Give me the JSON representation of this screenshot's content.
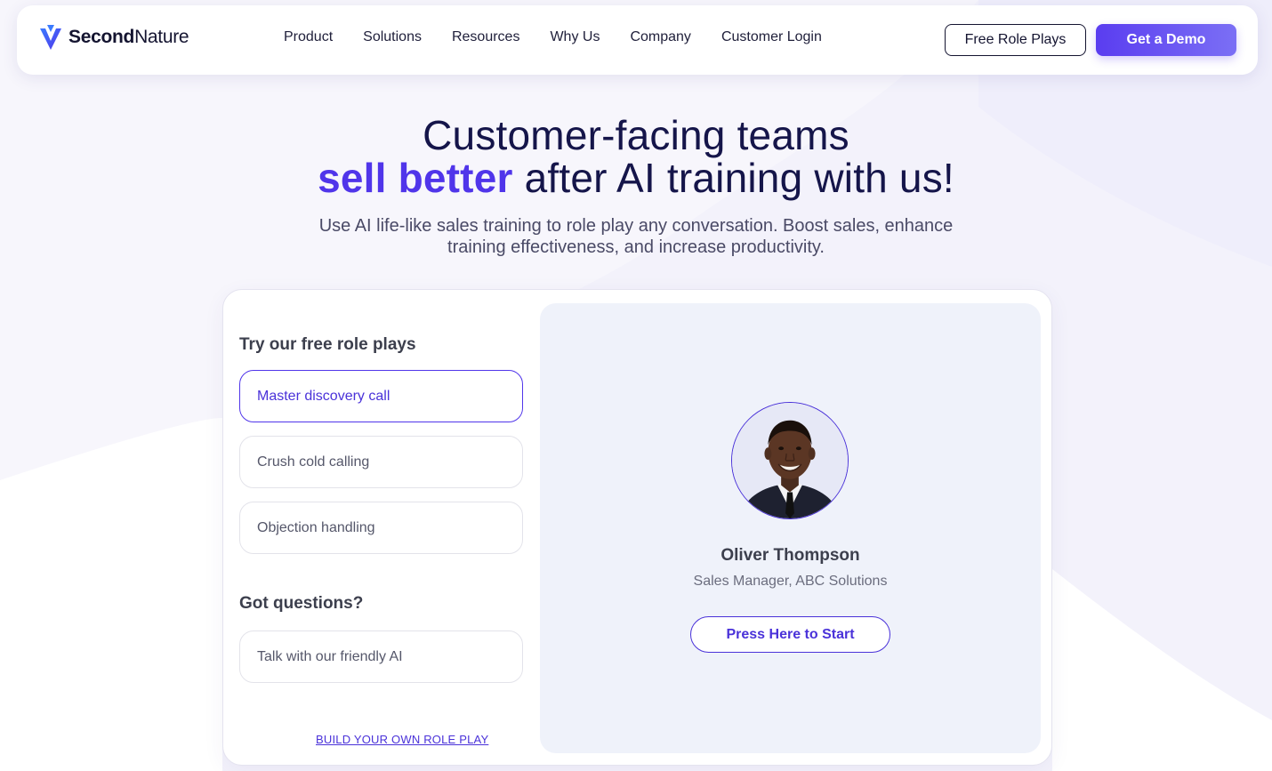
{
  "brand": {
    "name_bold": "Second",
    "name_light": "Nature",
    "logo_icon": "secondnature-logo-icon",
    "accent_color": "#5035ea",
    "primary_gradient": [
      "#5a3df0",
      "#7b6ff5"
    ]
  },
  "nav": {
    "links": [
      "Product",
      "Solutions",
      "Resources",
      "Why Us",
      "Company",
      "Customer Login"
    ],
    "free_role_plays_label": "Free Role Plays",
    "get_demo_label": "Get a Demo"
  },
  "hero": {
    "title_line1": "Customer-facing teams",
    "title_accent": "sell better",
    "title_rest": " after AI training with us!",
    "subtitle": "Use AI life-like sales training to role play any conversation. Boost sales, enhance training effectiveness, and increase productivity."
  },
  "role_plays": {
    "title": "Try our free role plays",
    "options": [
      {
        "label": "Master discovery call",
        "active": true
      },
      {
        "label": "Crush cold calling",
        "active": false
      },
      {
        "label": "Objection handling",
        "active": false
      }
    ],
    "questions_title": "Got questions?",
    "ai_chat_label": "Talk with our friendly AI",
    "build_link": "BUILD YOUR OWN ROLE PLAY"
  },
  "persona": {
    "name": "Oliver Thompson",
    "role": "Sales Manager, ABC Solutions",
    "start_label": "Press Here to Start",
    "avatar_icon": "person-avatar"
  }
}
